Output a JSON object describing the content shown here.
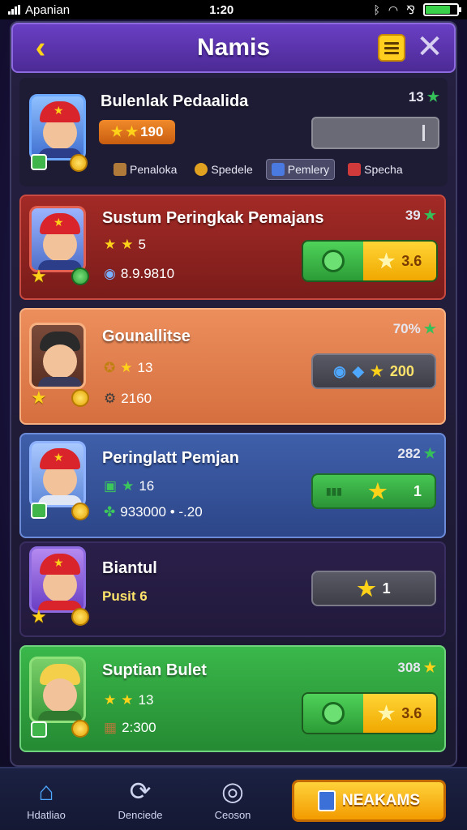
{
  "status_bar": {
    "carrier": "Apanian",
    "time": "1:20"
  },
  "header": {
    "title": "Namis"
  },
  "profile": {
    "name": "Bulenlak Pedaalida",
    "rank": "13",
    "score": "190",
    "tabs": [
      {
        "label": "Penaloka",
        "icon": "crate-icon"
      },
      {
        "label": "Spedele",
        "icon": "medal-icon"
      },
      {
        "label": "Pemlery",
        "icon": "shield-icon"
      },
      {
        "label": "Specha",
        "icon": "chart-icon"
      }
    ],
    "active_tab": 2
  },
  "rows": [
    {
      "name": "Sustum Peringkak Pemajans",
      "rank": "39",
      "stat1": "5",
      "stat2": "8.9.9810",
      "button_value": "3.6"
    },
    {
      "name": "Gounallitse",
      "rank": "70%",
      "stat1": "13",
      "stat2": "2160",
      "button_value": "200"
    },
    {
      "name": "Peringlatt Pemjan",
      "rank": "282",
      "stat1": "16",
      "stat2": "933000 • -.20",
      "button_value": "1"
    },
    {
      "name": "Biantul",
      "stat1": "Pusit 6",
      "button_value": "1"
    },
    {
      "name": "Suptian Bulet",
      "rank": "308",
      "stat1": "13",
      "stat2": "2:300",
      "button_value": "3.6"
    }
  ],
  "bottom_nav": {
    "items": [
      {
        "label": "Hdatliao",
        "icon": "home-icon"
      },
      {
        "label": "Denciede",
        "icon": "refresh-icon"
      },
      {
        "label": "Ceoson",
        "icon": "compass-icon"
      }
    ],
    "cta_label": "NEAKAMS"
  }
}
